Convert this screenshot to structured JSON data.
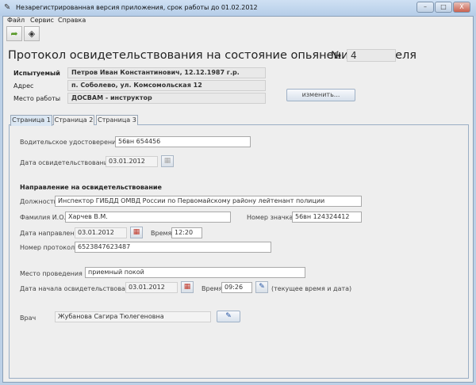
{
  "window": {
    "title": "Незарегистрированная версия приложения, срок работы до 01.02.2012",
    "minimize": "–",
    "maximize": "□",
    "close": "X"
  },
  "menu": [
    "Файл",
    "Сервис",
    "Справка"
  ],
  "toolbar": {
    "open_icon": "folder-arrow-icon",
    "edit_icon": "eraser-icon"
  },
  "header": {
    "title": "Протокол освидетельствования на состояние опьянения водителя",
    "number_label": "№",
    "number": "4"
  },
  "subject": {
    "name_label": "Испытуемый",
    "name": "Петров Иван Константинович, 12.12.1987 г.р.",
    "address_label": "Адрес",
    "address": "п. Соболево, ул. Комсомольская 12",
    "work_label": "Место работы",
    "work": "ДОСВАМ - инструктор",
    "change_button": "изменить..."
  },
  "tabs": [
    "Страница 1",
    "Страница 2",
    "Страница 3"
  ],
  "page1": {
    "license_label": "Водительское удостоверение",
    "license": "56вн 654456",
    "exam_date_label": "Дата освидетельствования",
    "exam_date": "03.01.2012",
    "section_title": "Направление на освидетельствование",
    "position_label": "Должность",
    "position": "Инспектор ГИБДД ОМВД России по Первомайскому району лейтенант полиции",
    "fio_label": "Фамилия И.О.",
    "fio": "Харчев В.М.",
    "badge_label": "Номер значка",
    "badge": "56вн 124324412",
    "direction_date_label": "Дата направления",
    "direction_date": "03.01.2012",
    "direction_time_label": "Время",
    "direction_time": "12:20",
    "protocol_label": "Номер протокола",
    "protocol": "6523847623487",
    "place_label": "Место проведения",
    "place": "приемный покой",
    "start_date_label": "Дата начала освидетельствования",
    "start_date": "03.01.2012",
    "start_time_label": "Время",
    "start_time": "09:26",
    "current_hint": "(текущее время и дата)",
    "doctor_label": "Врач",
    "doctor": "Жубанова Сагира Тюлегеновна"
  }
}
